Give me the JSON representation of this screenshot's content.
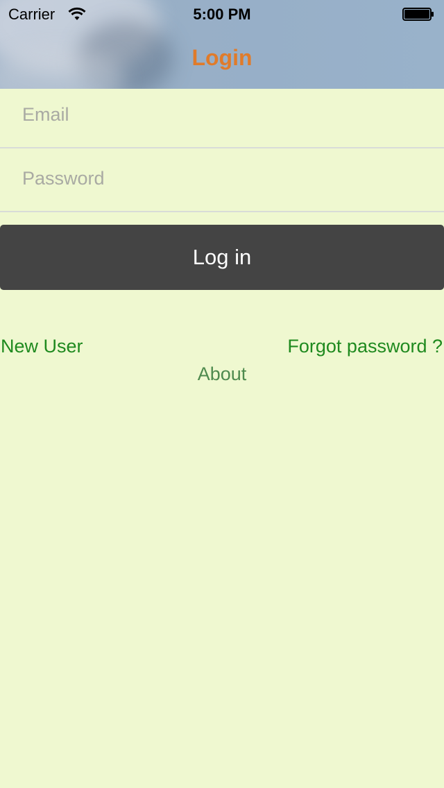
{
  "status_bar": {
    "carrier": "Carrier",
    "time": "5:00 PM",
    "wifi_icon": "wifi-icon",
    "battery_icon": "battery-icon"
  },
  "nav": {
    "title": "Login"
  },
  "form": {
    "email_placeholder": "Email",
    "email_value": "",
    "password_placeholder": "Password",
    "password_value": "",
    "login_label": "Log in"
  },
  "links": {
    "new_user": "New User",
    "forgot_password": "Forgot password ?",
    "about": "About"
  },
  "colors": {
    "background": "#eff8d0",
    "title": "#e07b2a",
    "button": "#444444",
    "link": "#1f8a1f"
  }
}
